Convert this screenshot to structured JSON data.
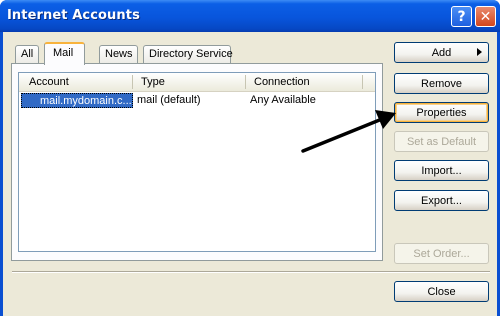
{
  "window": {
    "title": "Internet Accounts",
    "help_glyph": "?",
    "close_glyph": "✕"
  },
  "tabs": [
    {
      "label": "All",
      "active": false
    },
    {
      "label": "Mail",
      "active": true
    },
    {
      "label": "News",
      "active": false
    },
    {
      "label": "Directory Service",
      "active": false
    }
  ],
  "table": {
    "columns": [
      "Account",
      "Type",
      "Connection"
    ],
    "rows": [
      {
        "account": "mail.mydomain.c...",
        "type": "mail (default)",
        "connection": "Any Available",
        "icon": "mail-account-icon",
        "selected": true
      }
    ]
  },
  "buttons": {
    "add": "Add",
    "remove": "Remove",
    "properties": "Properties",
    "set_as_default": "Set as Default",
    "import": "Import...",
    "export": "Export...",
    "set_order": "Set Order...",
    "close": "Close"
  },
  "colors": {
    "title_bar": "#0855dc",
    "dialog_face": "#ece9d8",
    "selection": "#316ac5",
    "focus_ring": "#f8b33d"
  }
}
